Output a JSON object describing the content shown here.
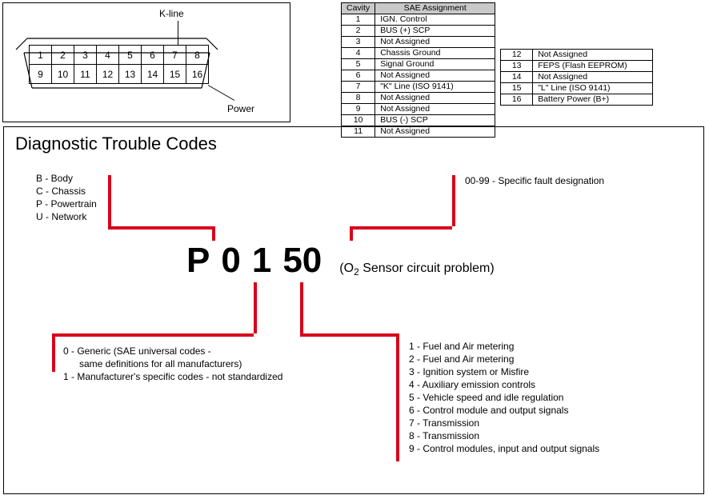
{
  "connector": {
    "kline_label": "K-line",
    "power_label": "Power",
    "row1": [
      "1",
      "2",
      "3",
      "4",
      "5",
      "6",
      "7",
      "8"
    ],
    "row2": [
      "9",
      "10",
      "11",
      "12",
      "13",
      "14",
      "15",
      "16"
    ]
  },
  "sae_table": {
    "headers": [
      "Cavity",
      "SAE Assignment"
    ],
    "rows1": [
      [
        "1",
        "IGN. Control"
      ],
      [
        "2",
        "BUS (+) SCP"
      ],
      [
        "3",
        "Not Assigned"
      ],
      [
        "4",
        "Chassis Ground"
      ],
      [
        "5",
        "Signal Ground"
      ],
      [
        "6",
        "Not Assigned"
      ],
      [
        "7",
        "\"K\" Line (ISO 9141)"
      ],
      [
        "8",
        "Not Assigned"
      ],
      [
        "9",
        "Not Assigned"
      ],
      [
        "10",
        "BUS (-) SCP"
      ],
      [
        "11",
        "Not Assigned"
      ]
    ],
    "rows2": [
      [
        "12",
        "Not Assigned"
      ],
      [
        "13",
        "FEPS (Flash EEPROM)"
      ],
      [
        "14",
        "Not Assigned"
      ],
      [
        "15",
        "\"L\" Line (ISO 9141)"
      ],
      [
        "16",
        "Battery Power (B+)"
      ]
    ]
  },
  "dtc": {
    "title": "Diagnostic Trouble Codes",
    "code_parts": [
      "P",
      "0",
      "1",
      "50"
    ],
    "code_desc_pre": "(O",
    "code_desc_sub": "2",
    "code_desc_post": " Sensor circuit problem)",
    "letters_list": "B - Body\nC - Chassis\nP - Powertrain\nU - Network",
    "fault_desc": "00-99 - Specific fault designation",
    "digit2_list": "0 - Generic (SAE universal codes -\n      same definitions for all manufacturers)\n1 - Manufacturer's specific codes - not standardized",
    "system_list": "1 - Fuel and Air metering\n2 - Fuel and Air metering\n3 - Ignition system or Misfire\n4 - Auxiliary emission controls\n5 - Vehicle speed and idle regulation\n6 - Control module and output signals\n7 - Transmission\n8 - Transmission\n9 - Control modules, input and output signals"
  },
  "chart_data": {
    "type": "table",
    "title": "OBD-II 16-pin connector SAE J1962 cavity assignments and DTC structure",
    "connector_pinout": [
      {
        "cavity": 1,
        "assignment": "IGN. Control"
      },
      {
        "cavity": 2,
        "assignment": "BUS (+) SCP"
      },
      {
        "cavity": 3,
        "assignment": "Not Assigned"
      },
      {
        "cavity": 4,
        "assignment": "Chassis Ground"
      },
      {
        "cavity": 5,
        "assignment": "Signal Ground"
      },
      {
        "cavity": 6,
        "assignment": "Not Assigned"
      },
      {
        "cavity": 7,
        "assignment": "\"K\" Line (ISO 9141)"
      },
      {
        "cavity": 8,
        "assignment": "Not Assigned"
      },
      {
        "cavity": 9,
        "assignment": "Not Assigned"
      },
      {
        "cavity": 10,
        "assignment": "BUS (-) SCP"
      },
      {
        "cavity": 11,
        "assignment": "Not Assigned"
      },
      {
        "cavity": 12,
        "assignment": "Not Assigned"
      },
      {
        "cavity": 13,
        "assignment": "FEPS (Flash EEPROM)"
      },
      {
        "cavity": 14,
        "assignment": "Not Assigned"
      },
      {
        "cavity": 15,
        "assignment": "\"L\" Line (ISO 9141)"
      },
      {
        "cavity": 16,
        "assignment": "Battery Power (B+)"
      }
    ],
    "dtc_example": {
      "code": "P0150",
      "meaning": "O2 Sensor circuit problem",
      "position1_letter": {
        "B": "Body",
        "C": "Chassis",
        "P": "Powertrain",
        "U": "Network"
      },
      "position2_digit": {
        "0": "Generic (SAE universal codes – same definitions for all manufacturers)",
        "1": "Manufacturer's specific codes – not standardized"
      },
      "position3_digit": {
        "1": "Fuel and Air metering",
        "2": "Fuel and Air metering",
        "3": "Ignition system or Misfire",
        "4": "Auxiliary emission controls",
        "5": "Vehicle speed and idle regulation",
        "6": "Control module and output signals",
        "7": "Transmission",
        "8": "Transmission",
        "9": "Control modules, input and output signals"
      },
      "position45_digits": "00-99 – Specific fault designation"
    }
  }
}
